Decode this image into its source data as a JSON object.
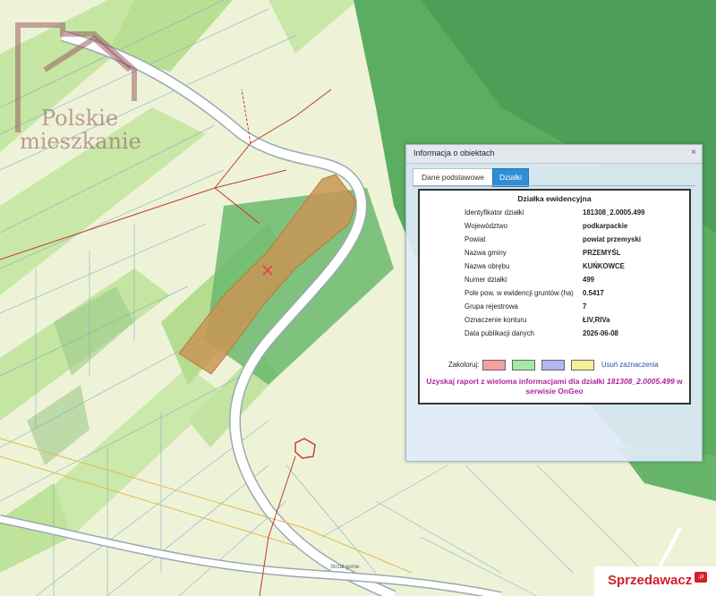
{
  "watermark": {
    "line1": "Polskie",
    "line2": "mieszkanie"
  },
  "map": {
    "street_label": "Strzał gorne"
  },
  "colors": {
    "forest": "#5cad62",
    "forest_dark": "#4e9e58",
    "field": "#eef3d8",
    "meadow": "#bfe39a",
    "road": "#ffffff",
    "highlight": "#c99555",
    "boundary": "#c0392b",
    "accent": "#2e8fd6",
    "report": "#b0239a"
  },
  "panel": {
    "title": "Informacja o obiektach",
    "close": "×",
    "tabs": [
      {
        "label": "Dane podstawowe"
      },
      {
        "label": "Działki"
      }
    ],
    "section_title": "Działka ewidencyjna",
    "fields": [
      {
        "label": "Identyfikator działki",
        "value": "181308_2.0005.499"
      },
      {
        "label": "Województwo",
        "value": "podkarpackie"
      },
      {
        "label": "Powiat",
        "value": "powiat przemyski"
      },
      {
        "label": "Nazwa gminy",
        "value": "PRZEMYŚL"
      },
      {
        "label": "Nazwa obrębu",
        "value": "KUŃKOWCE"
      },
      {
        "label": "Numer działki",
        "value": "499"
      },
      {
        "label": "Pole pow. w ewidencji gruntów (ha)",
        "value": "0.5417"
      },
      {
        "label": "Grupa rejestrowa",
        "value": "7"
      },
      {
        "label": "Oznaczenie konturu",
        "value": "ŁIV,RIVa"
      },
      {
        "label": "Data publikacji danych",
        "value": "2026-06-08"
      }
    ],
    "colorize_label": "Zakoloruj:",
    "swatches": [
      {
        "name": "red",
        "color": "#f3a0a0"
      },
      {
        "name": "green",
        "color": "#a4eaa4"
      },
      {
        "name": "blue",
        "color": "#b4b4f0"
      },
      {
        "name": "yellow",
        "color": "#f3ee9a"
      }
    ],
    "clear_label": "Usuń zaznaczenia",
    "report_prefix": "Uzyskaj raport z wieloma informacjami dla działki ",
    "report_id": "181308_2.0005.499",
    "report_suffix": " w serwisie OnGeo"
  },
  "brand": {
    "name": "Sprzedawacz",
    "badge": ".pl"
  }
}
